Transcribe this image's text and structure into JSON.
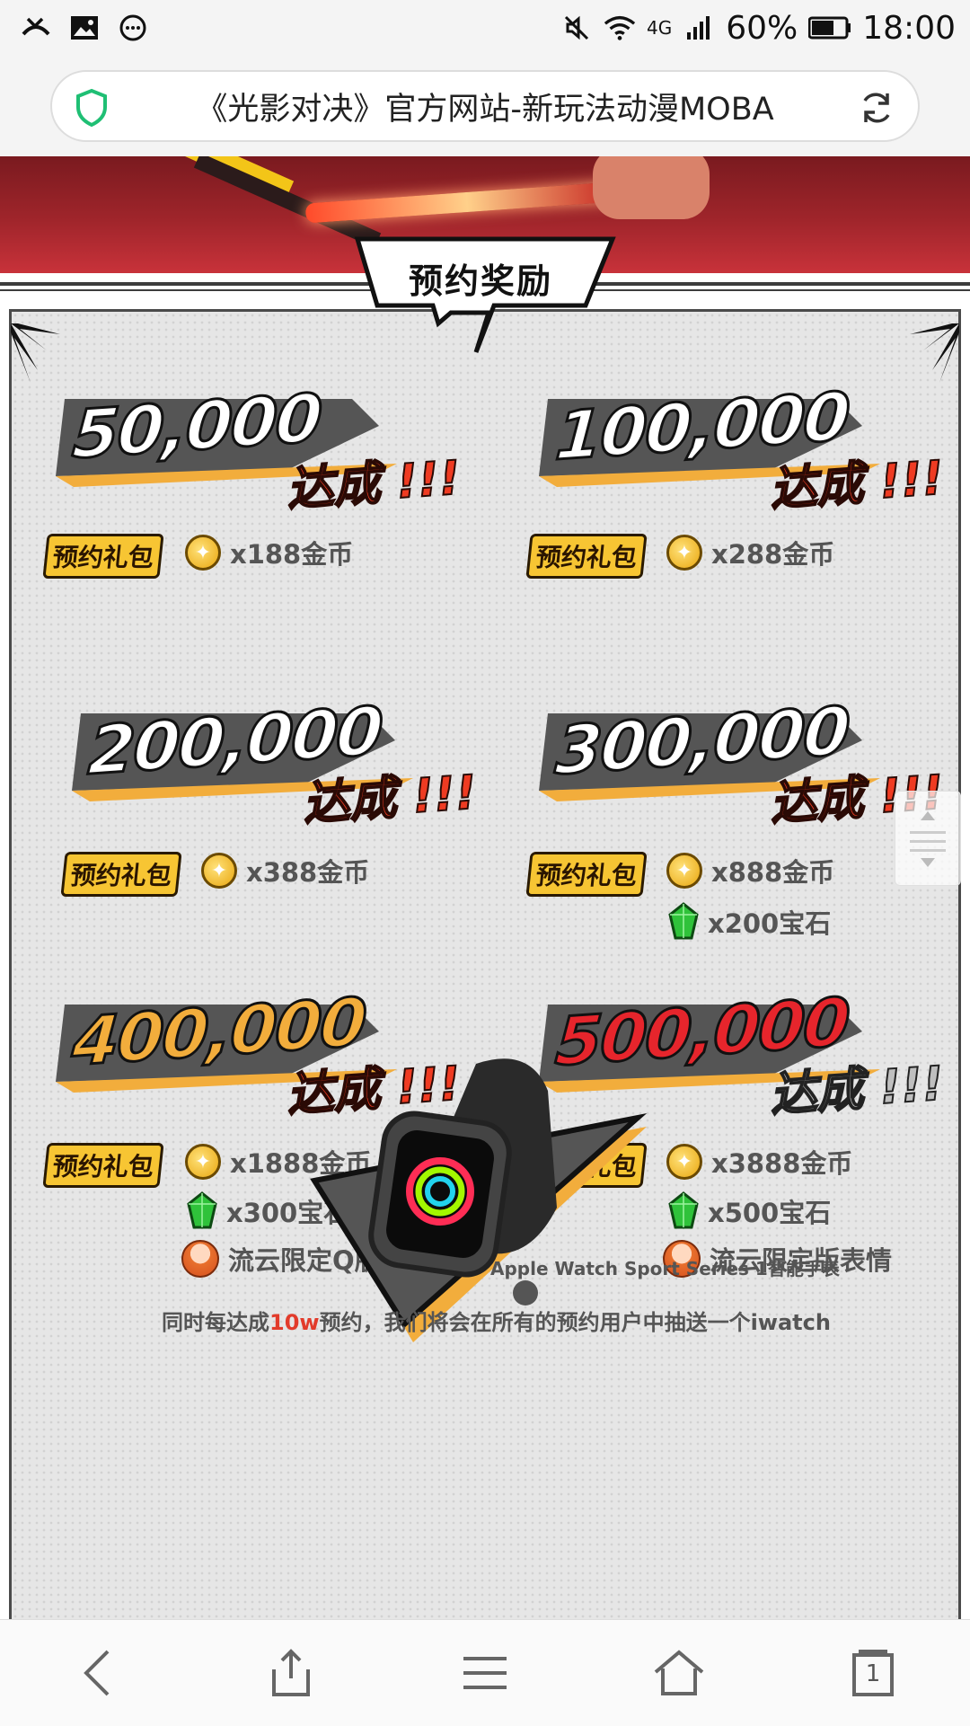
{
  "status_bar": {
    "battery": "60%",
    "time": "18:00",
    "network": "4G"
  },
  "browser": {
    "url_title": "《光影对决》官方网站-新玩法动漫MOBA"
  },
  "section": {
    "title": "预约奖励"
  },
  "tiers": [
    {
      "count": "50,000",
      "done": "达成 !!!",
      "gift_label": "预约礼包",
      "rewards": [
        {
          "icon": "coin-icon",
          "text": "x188金币"
        }
      ]
    },
    {
      "count": "100,000",
      "done": "达成 !!!",
      "gift_label": "预约礼包",
      "rewards": [
        {
          "icon": "coin-icon",
          "text": "x288金币"
        }
      ]
    },
    {
      "count": "200,000",
      "done": "达成 !!!",
      "gift_label": "预约礼包",
      "rewards": [
        {
          "icon": "coin-icon",
          "text": "x388金币"
        }
      ]
    },
    {
      "count": "300,000",
      "done": "达成 !!!",
      "gift_label": "预约礼包",
      "rewards": [
        {
          "icon": "coin-icon",
          "text": "x888金币"
        },
        {
          "icon": "gem-icon",
          "text": "x200宝石"
        }
      ]
    },
    {
      "count": "400,000",
      "done": "达成 !!!",
      "gift_label": "预约礼包",
      "rewards": [
        {
          "icon": "coin-icon",
          "text": "x1888金币"
        },
        {
          "icon": "gem-icon",
          "text": "x300宝石"
        },
        {
          "icon": "avatar-icon",
          "text": "流云限定Q版头像"
        }
      ]
    },
    {
      "count": "500,000",
      "done": "达成 !!!",
      "gift_label": "预约礼包",
      "rewards": [
        {
          "icon": "coin-icon",
          "text": "x3888金币"
        },
        {
          "icon": "gem-icon",
          "text": "x500宝石"
        },
        {
          "icon": "emoji-icon",
          "text": "流云限定版表情"
        }
      ]
    }
  ],
  "prize": {
    "caption": "Apple Watch Sport Series 1智能手表",
    "note_prefix": "同时每达成",
    "note_highlight": "10w",
    "note_suffix": "预约，我们将会在所有的预约用户中抽送一个iwatch"
  },
  "nav": {
    "tabs_count": "1"
  },
  "colors": {
    "accent_gold": "#f7c533",
    "accent_red": "#ef3b22",
    "panel_bg": "#e6e6e6",
    "shield_green": "#1fbf74"
  }
}
